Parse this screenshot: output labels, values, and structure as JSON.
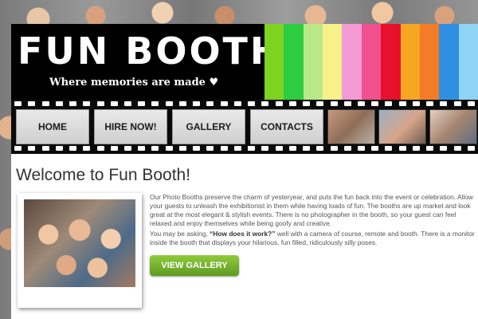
{
  "header": {
    "logo": "FUN BOOTH",
    "tagline": "Where memories are made ♥",
    "stripe_colors": [
      "#7ed321",
      "#2ecc40",
      "#b8e986",
      "#f7f18a",
      "#f59ad6",
      "#f0508e",
      "#e8112d",
      "#f5a623",
      "#f57c26",
      "#2f8fe0",
      "#8fd3f5"
    ]
  },
  "nav": {
    "items": [
      {
        "label": "HOME"
      },
      {
        "label": "HIRE NOW!"
      },
      {
        "label": "GALLERY"
      },
      {
        "label": "CONTACTS"
      }
    ]
  },
  "main": {
    "heading": "Welcome to Fun Booth!",
    "para1": "Our Photo Booths preserve the charm of yesteryear, and puts the fun back into the event or celebration.  Allow your guests to unleash the exhibitionist in them while having loads of fun.  The booths are up market and look great at the most elegant & stylish events.  There is no photographer in the booth, so your guest can feel relaxed and enjoy themselves while being goofy and creative.",
    "para2_prefix": "You may be asking, ",
    "para2_question": "“How does it work?”",
    "para2_rest": " well with a camera of course, remote and booth.  There is a monitor inside the booth that displays your hilarious, fun filled, ridiculously silly poses.",
    "gallery_button": "VIEW GALLERY"
  }
}
